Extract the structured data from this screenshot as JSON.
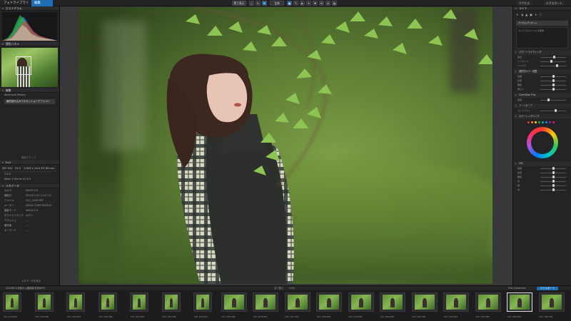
{
  "tabs": {
    "library": "フォトライブラリ",
    "edit": "編集"
  },
  "toolbar": {
    "zoom": "実寸表示",
    "fit": "全体",
    "export_label": "エクスポート",
    "settings": "アクセス"
  },
  "left": {
    "histogram_title": "ヒストグラム",
    "navigator_title": "閲覧パネル",
    "history_title": "編集",
    "history_item": "Advanced History",
    "history_entry": "最終読み込みでのセッションデフォルト",
    "undo_label": "最終ステップ",
    "exif_title": "Exif",
    "exif_cells": [
      "ISO 100",
      "f/2.0",
      "1/320 s",
      "±0.0 EV",
      "85 mm"
    ],
    "camera_model": "Nikon Z 85mm f/1.8 S",
    "lens": "Z 8 S",
    "info_rows": [
      {
        "label": "カメラ",
        "value": "NIKON Z 8"
      },
      {
        "label": "撮影日",
        "value": "2020/11/12 14:47:32"
      },
      {
        "label": "ファイル",
        "value": "DSC_2049.NEF"
      },
      {
        "label": "メーカー",
        "value": "NIKON CORPORATION"
      },
      {
        "label": "撮影モード",
        "value": "NIKON Z 8"
      },
      {
        "label": "ホワイトバランス",
        "value": "AUTO"
      },
      {
        "label": "フラッシュ",
        "value": "---"
      },
      {
        "label": "著作者",
        "value": "---"
      },
      {
        "label": "キーワード",
        "value": "---"
      }
    ],
    "metadata_label": "メタデータ",
    "metadata_footer": "メタデータを表示"
  },
  "right": {
    "panel_title": "ライト",
    "preset_title": "カスタムプリセット",
    "profile_note": "カメラプロファイルを使用",
    "sections": [
      {
        "title": "スマートライティング",
        "rows": [
          "露出",
          "ハイライト",
          "シャドウ"
        ]
      },
      {
        "title": "選択的カラー調整",
        "rows": [
          "色相",
          "彩度",
          "輝度",
          "明るさ"
        ]
      },
      {
        "title": "ClearView Plus",
        "rows": [
          "強度"
        ]
      },
      {
        "title": "トーンカーブ",
        "rows": [
          "コントラスト"
        ]
      },
      {
        "title": "カラーホイール",
        "rows": [
          "色相",
          "彩度",
          "輝度",
          "赤",
          "緑",
          "青"
        ]
      }
    ],
    "color_section": "カラーレンダリング",
    "hsl_title": "HSL"
  },
  "filmbar": {
    "path": "2020年11月秋の公園撮影写真NEFS",
    "count": "1086",
    "collection": "Film Collection",
    "sort": "並べ替え",
    "export": "エクスポート"
  },
  "filmstrip": {
    "labels": [
      "DSC_2048.NEF",
      "DSC_2049.NEF",
      "DSC_2050.NEF",
      "DSC_2051.NEF",
      "DSC_2052.NEF",
      "DSC_2053.NEF",
      "DSC_2054.NEF",
      "DSC_2055.NEF",
      "DSC_2056.NEF",
      "DSC_2057.NEF",
      "DSC_2058.NEF",
      "DSC_2059.NEF",
      "DSC_2060.NEF",
      "DSC_2061.NEF",
      "DSC_2062.NEF",
      "DSC_2063.NEF",
      "DSC_2064.NEF",
      "DSC_2065.NEF"
    ]
  },
  "colors": {
    "accent": "#1f6fb5",
    "panel": "#242426",
    "bg": "#1c1c1e"
  }
}
